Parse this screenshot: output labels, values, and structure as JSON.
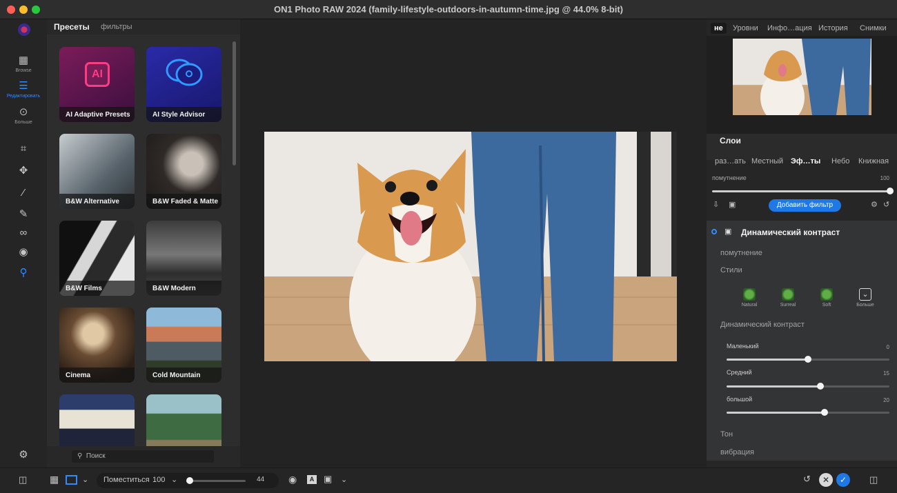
{
  "window": {
    "title": "ON1 Photo RAW 2024 (family-lifestyle-outdoors-in-autumn-time.jpg @ 44.0% 8-bit)"
  },
  "rail": {
    "browse_label": "Browse",
    "edit_label": "Редактировать",
    "more_label": "Больше"
  },
  "presets_panel": {
    "tab_presets": "Пресеты",
    "tab_filters": "фильтры",
    "tiles": [
      {
        "label": "AI Adaptive Presets"
      },
      {
        "label": "AI Style Advisor"
      },
      {
        "label": "B&W Alternative"
      },
      {
        "label": "B&W Faded & Matte"
      },
      {
        "label": "B&W Films"
      },
      {
        "label": "B&W Modern"
      },
      {
        "label": "Cinema"
      },
      {
        "label": "Cold Mountain"
      },
      {
        "label": ""
      },
      {
        "label": ""
      }
    ],
    "ai_badge": "AI",
    "search_placeholder": "Поиск"
  },
  "right_panel": {
    "tabs": [
      "не",
      "Уровни",
      "Инфо…ация",
      "История",
      "Снимки"
    ],
    "layers_title": "Слои",
    "effect_tabs": [
      "раз…ать",
      "Местный",
      "Эф…ты",
      "Небо",
      "Книжная"
    ],
    "opacity_label": "помутнение",
    "opacity_value": "100",
    "opacity_level": 1.0,
    "add_filter_label": "Добавить фильтр",
    "filter": {
      "name": "Динамический контраст",
      "opacity_label": "помутнение",
      "styles_label": "Стили",
      "styles": [
        "Natural",
        "Surreal",
        "Soft",
        "Больше"
      ],
      "section_label": "Динамический контраст",
      "sliders": [
        {
          "label": "Маленький",
          "value": "0",
          "level": 0.5
        },
        {
          "label": "Средний",
          "value": "15",
          "level": 0.575
        },
        {
          "label": "большой",
          "value": "20",
          "level": 0.6
        }
      ],
      "tone_label": "Тон",
      "vibrance_label": "вибрация"
    }
  },
  "bottom": {
    "fit_label": "Поместиться",
    "zoom_value": "100",
    "zoom_slider_value": "44",
    "zoom_level": 0.06
  }
}
